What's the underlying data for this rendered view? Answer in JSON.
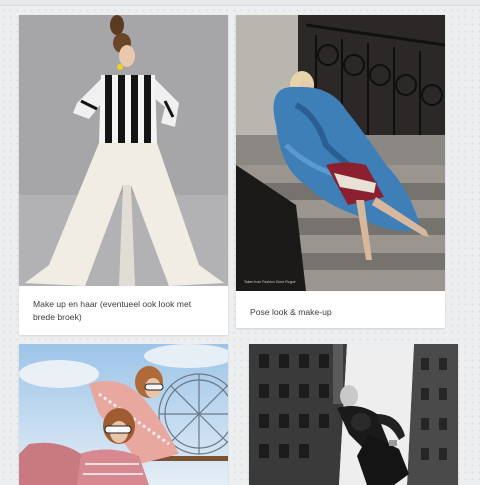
{
  "cards": [
    {
      "caption": "Make up en haar (eventueel ook look met brede broek)",
      "photo": "woman-striped-top-wide-trousers"
    },
    {
      "caption": "Pose look & make-up",
      "photo": "woman-blue-feather-coat-on-stairs"
    },
    {
      "caption": "",
      "photo": "two-women-sunglasses-ferris-wheel"
    },
    {
      "caption": "",
      "photo": "couple-black-and-white-city-street"
    }
  ],
  "photo_credit": "Taken from Fashion Gone Rogue"
}
